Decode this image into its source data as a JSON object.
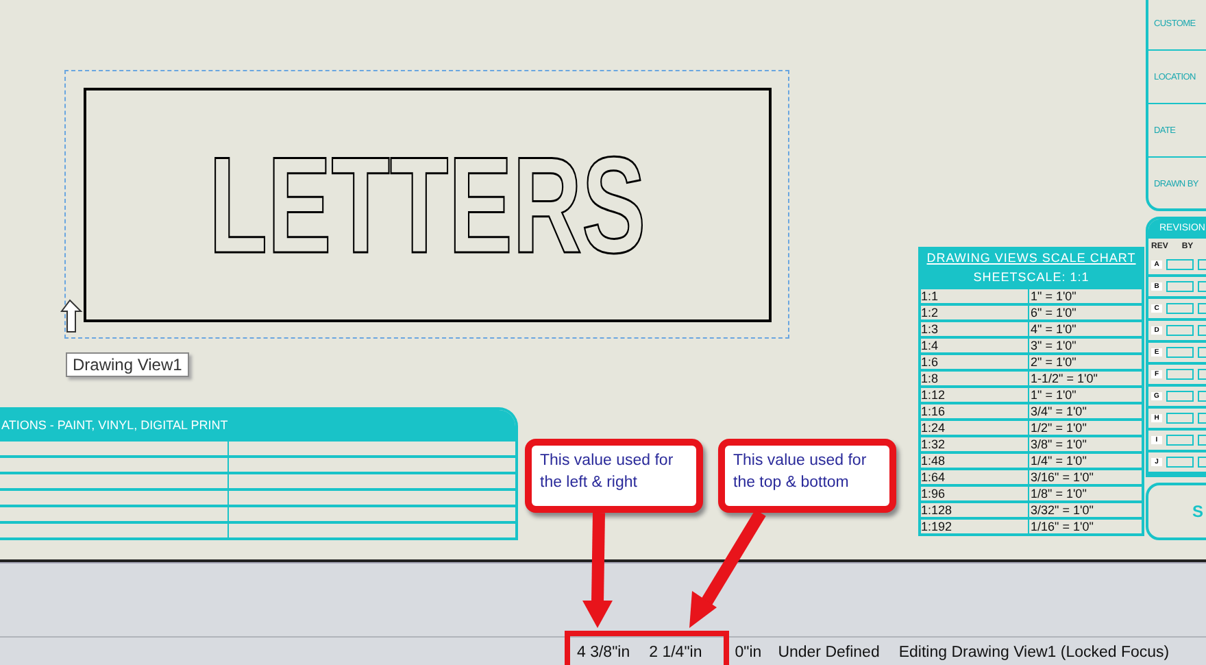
{
  "drawing_view": {
    "label": "LETTERS",
    "tooltip": "Drawing View1"
  },
  "notes_table": {
    "title": "ATIONS - PAINT, VINYL, DIGITAL PRINT"
  },
  "scale_chart": {
    "title": "DRAWING VIEWS SCALE CHART",
    "sheet_scale": "SHEETSCALE: 1:1",
    "rows": [
      {
        "scale": "1:1",
        "equivalent": "1\" = 1'0\""
      },
      {
        "scale": "1:2",
        "equivalent": "6\" = 1'0\""
      },
      {
        "scale": "1:3",
        "equivalent": "4\" = 1'0\""
      },
      {
        "scale": "1:4",
        "equivalent": "3\" = 1'0\""
      },
      {
        "scale": "1:6",
        "equivalent": "2\" = 1'0\""
      },
      {
        "scale": "1:8",
        "equivalent": "1-1/2\" = 1'0\""
      },
      {
        "scale": "1:12",
        "equivalent": "1\" = 1'0\""
      },
      {
        "scale": "1:16",
        "equivalent": "3/4\" = 1'0\""
      },
      {
        "scale": "1:24",
        "equivalent": "1/2\" = 1'0\""
      },
      {
        "scale": "1:32",
        "equivalent": "3/8\" = 1'0\""
      },
      {
        "scale": "1:48",
        "equivalent": "1/4\" = 1'0\""
      },
      {
        "scale": "1:64",
        "equivalent": "3/16\" = 1'0\""
      },
      {
        "scale": "1:96",
        "equivalent": "1/8\" = 1'0\""
      },
      {
        "scale": "1:128",
        "equivalent": "3/32\" = 1'0\""
      },
      {
        "scale": "1:192",
        "equivalent": "1/16\" = 1'0\""
      }
    ]
  },
  "title_block": {
    "fields": [
      "CUSTOME",
      "LOCATION",
      "DATE",
      "DRAWN BY"
    ],
    "revisions": {
      "title": "REVISION",
      "columns": [
        "REV",
        "BY"
      ],
      "rows": [
        "A",
        "B",
        "C",
        "D",
        "E",
        "F",
        "G",
        "H",
        "I",
        "J"
      ]
    },
    "sheet_label": "S"
  },
  "callouts": [
    {
      "text": "This value used for the left & right"
    },
    {
      "text": "This value used for the top & bottom"
    }
  ],
  "status_bar": [
    "4 3/8\"in",
    "2 1/4\"in",
    "0\"in",
    "Under Defined",
    "Editing Drawing View1 (Locked Focus)"
  ]
}
